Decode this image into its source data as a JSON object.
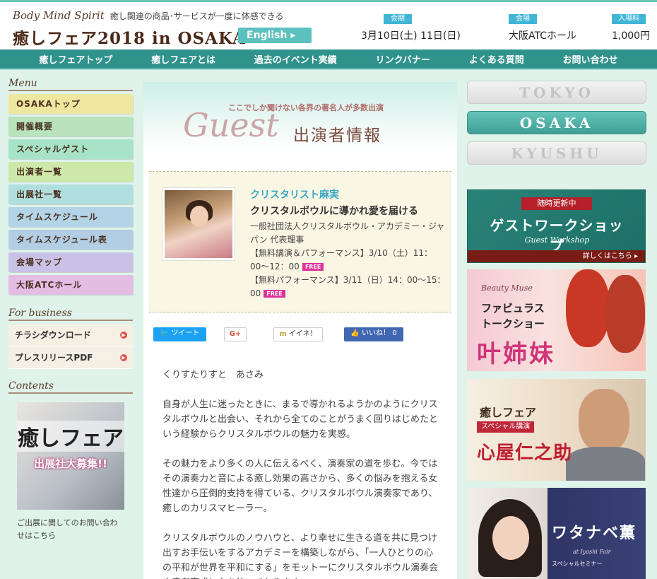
{
  "header": {
    "tagline_en": "Body Mind Spirit",
    "tagline_ja": "癒し関連の商品･サービスが一度に体感できる",
    "logo": "癒しフェア2018 in OSAKA",
    "english_button": "English",
    "period_label": "会期",
    "period_value": "3月10日(土) 11日(日)",
    "venue_label": "会場",
    "venue_value": "大阪ATCホール",
    "fee_label": "入場料",
    "fee_value": "1,000円"
  },
  "nav": [
    "癒しフェアトップ",
    "癒しフェアとは",
    "過去のイベント実績",
    "リンクバナー",
    "よくある質問",
    "お問い合わせ"
  ],
  "sidebar": {
    "menu_title": "Menu",
    "menu": [
      {
        "label": "OSAKAトップ",
        "color": "#efe7a0"
      },
      {
        "label": "開催概要",
        "color": "#b9e3bd"
      },
      {
        "label": "スペシャルゲスト",
        "color": "#a7e3c7"
      },
      {
        "label": "出演者一覧",
        "color": "#cde8a8"
      },
      {
        "label": "出展社一覧",
        "color": "#b0dfdd"
      },
      {
        "label": "タイムスケジュール",
        "color": "#b2d4e6"
      },
      {
        "label": "タイムスケジュール表",
        "color": "#b2cde4"
      },
      {
        "label": "会場マップ",
        "color": "#cac2e6"
      },
      {
        "label": "大阪ATCホール",
        "color": "#e3bde4"
      }
    ],
    "business_title": "For business",
    "business": [
      "チラシダウンロード",
      "プレスリリースPDF"
    ],
    "contents_title": "Contents",
    "promo_title": "癒しフェア",
    "promo_sub": "出展社大募集!!",
    "promo_contact": "ご出展に関してのお問い合わせはこちら"
  },
  "main": {
    "guest_sub": "ここでしか聞けない各界の著名人が多数出演",
    "guest_script": "Guest",
    "guest_ja": "出演者情報",
    "name": "クリスタリスト麻実",
    "title": "クリスタルボウルに導かれ愛を届ける",
    "org": "一般社団法人クリスタルボウル・アカデミー・ジャパン 代表理事",
    "event1": "【無料講演＆パフォーマンス】3/10（土）11：00〜12：00",
    "event2": "【無料パフォーマンス】3/11（日）14：00〜15：00",
    "free_badge": "FREE",
    "social": {
      "tweet": "ツイート",
      "gplus": "G+",
      "mixi": "イイネ！",
      "fb": "いいね！ 0"
    },
    "paragraphs": [
      "くりすたりすと　あさみ",
      "自身が人生に迷ったときに、まるで導かれるようかのようにクリスタルボウルと出会い、それから全てのことがうまく回りはじめたという経験からクリスタルボウルの魅力を実感。",
      "その魅力をより多くの人に伝えるべく、演奏家の道を歩む。今ではその演奏力と音による癒し効果の高さから、多くの悩みを抱える女性達から圧倒的支持を得ている、クリスタルボウル演奏家であり、癒しのカリスマヒーラー。",
      "クリスタルボウルのノウハウと、より幸せに生きる道を共に見つけ出すお手伝いをするアカデミーを構築しながら、「一人ひとりの心の平和が世界を平和にする」をモットーにクリスタルボウル演奏会や奏者育成に力を注いでおります。"
    ]
  },
  "right": {
    "cities": [
      "TOKYO",
      "OSAKA",
      "KYUSHU"
    ],
    "banner1": {
      "badge": "随時更新中",
      "title": "ゲストワークショップ",
      "sub": "Guest Workshop",
      "more": "詳しくはこちら ▸"
    },
    "banner2": {
      "brand": "Beauty Muse",
      "t1": "ファビュラス",
      "t2": "トークショー",
      "name": "叶姉妹"
    },
    "banner3": {
      "a": "癒しフェア",
      "b": "スペシャル講演",
      "c": "心屋仁之助"
    },
    "banner4": {
      "name": "ワタナベ薫",
      "sub": "at Iyashi Fair",
      "sub2": "スペシャルセミナー"
    }
  }
}
